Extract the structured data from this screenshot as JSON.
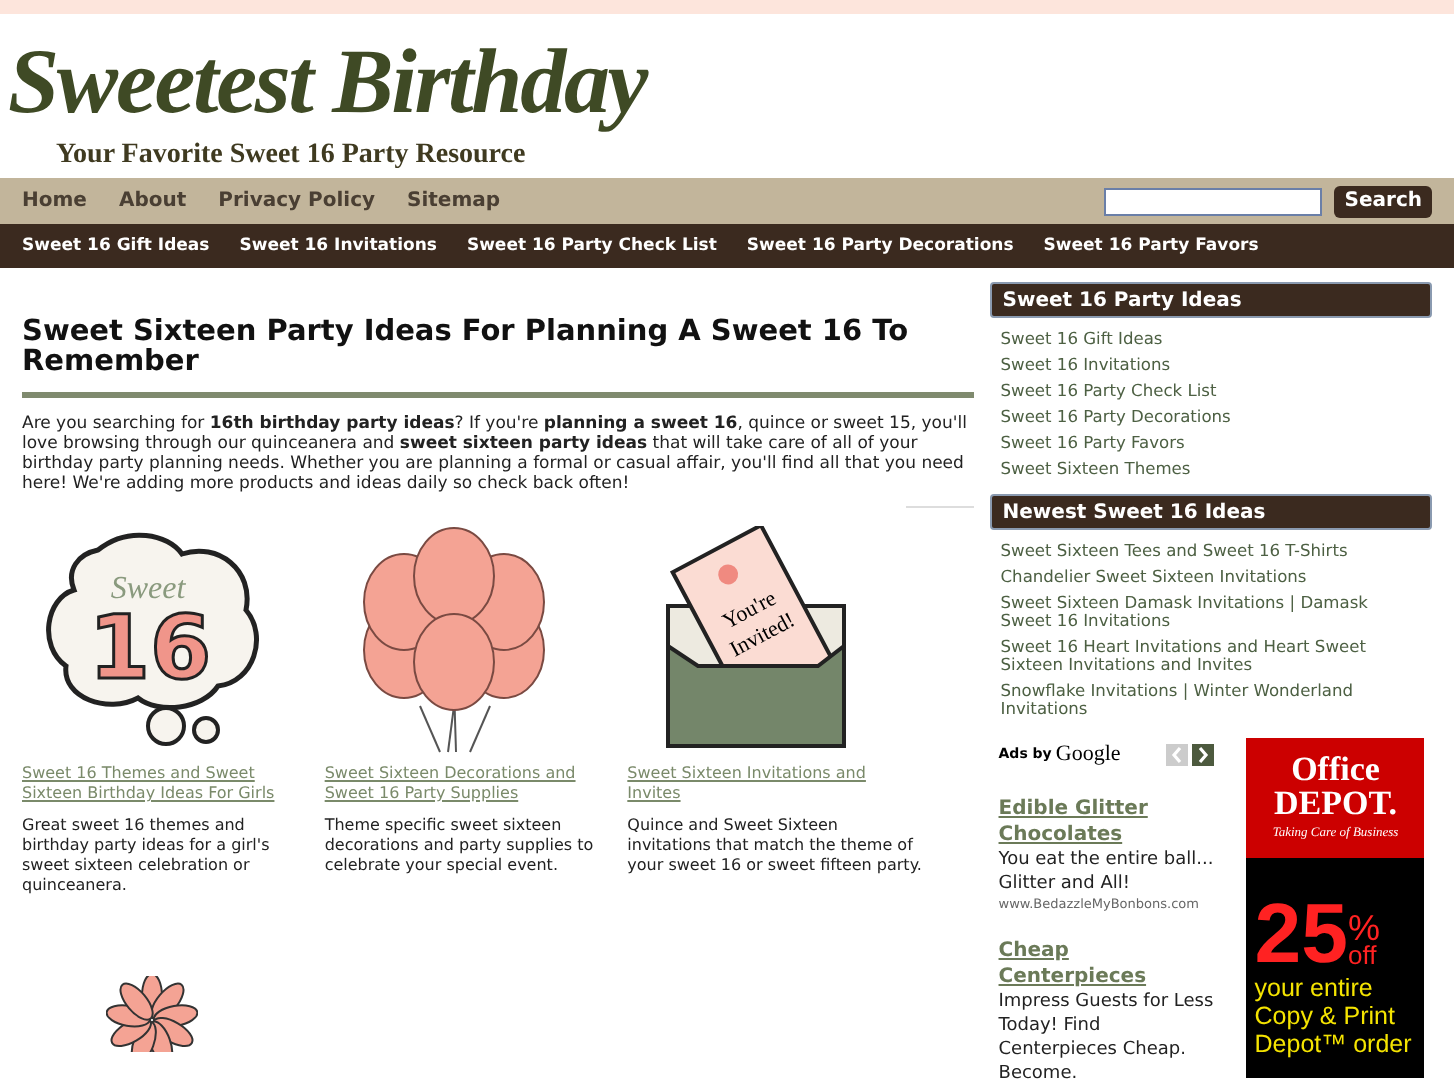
{
  "logo": {
    "title": "Sweetest Birthday",
    "tagline": "Your Favorite Sweet 16 Party Resource"
  },
  "nav": [
    "Home",
    "About",
    "Privacy Policy",
    "Sitemap"
  ],
  "search": {
    "button": "Search"
  },
  "category_nav": [
    "Sweet 16 Gift Ideas",
    "Sweet 16 Invitations",
    "Sweet 16 Party Check List",
    "Sweet 16 Party Decorations",
    "Sweet 16 Party Favors"
  ],
  "article": {
    "title": "Sweet Sixteen Party Ideas For Planning A Sweet 16 To Remember",
    "intro": "Are you searching for **16th birthday party ideas**? If you're **planning a sweet 16**, quince or sweet 15, you'll love browsing through our quinceanera and **sweet sixteen party ideas** that will take care of all of your birthday party planning needs. Whether you are planning a formal or casual affair, you'll find all that you need here! We're adding more products and ideas daily so check back often!"
  },
  "features": [
    {
      "kind": "cloud",
      "art_text": [
        "Sweet",
        "16"
      ],
      "link": "Sweet 16 Themes and Sweet Sixteen Birthday Ideas For Girls",
      "text": "Great sweet 16 themes and birthday party ideas for a girl's sweet sixteen celebration or quinceanera."
    },
    {
      "kind": "balloons",
      "link": "Sweet Sixteen Decorations and Sweet 16 Party Supplies",
      "text": "Theme specific sweet sixteen decorations and party supplies to celebrate your special event."
    },
    {
      "kind": "invitation",
      "art_text": [
        "You're",
        "Invited!"
      ],
      "link": "Sweet Sixteen Invitations and Invites",
      "text": "Quince and Sweet Sixteen invitations that match the theme of your sweet 16 or sweet fifteen party."
    },
    {
      "kind": "flower"
    }
  ],
  "sidebar": [
    {
      "title": "Sweet 16 Party Ideas",
      "links": [
        "Sweet 16 Gift Ideas",
        "Sweet 16 Invitations",
        "Sweet 16 Party Check List",
        "Sweet 16 Party Decorations",
        "Sweet 16 Party Favors",
        "Sweet Sixteen Themes"
      ]
    },
    {
      "title": "Newest Sweet 16 Ideas",
      "links": [
        "Sweet Sixteen Tees and Sweet 16 T-Shirts",
        "Chandelier Sweet Sixteen Invitations",
        "Sweet Sixteen Damask Invitations | Damask Sweet 16 Invitations",
        "Sweet 16 Heart Invitations and Heart Sweet Sixteen Invitations and Invites",
        "Snowflake Invitations | Winter Wonderland Invitations"
      ]
    }
  ],
  "ads": {
    "label": "Ads by",
    "brand": "Google",
    "items": [
      {
        "title": "Edible Glitter Chocolates",
        "text": "You eat the entire ball... Glitter and All!",
        "url": "www.BedazzleMyBonbons.com"
      },
      {
        "title": "Cheap Centerpieces",
        "text": "Impress Guests for Less Today! Find Centerpieces Cheap. Become."
      }
    ]
  },
  "banner": {
    "brand": "Office DEPOT.",
    "slogan": "Taking Care of Business",
    "offer": "25",
    "percent": "%",
    "off": "off",
    "text": "your entire Copy & Print Depot™ order"
  }
}
